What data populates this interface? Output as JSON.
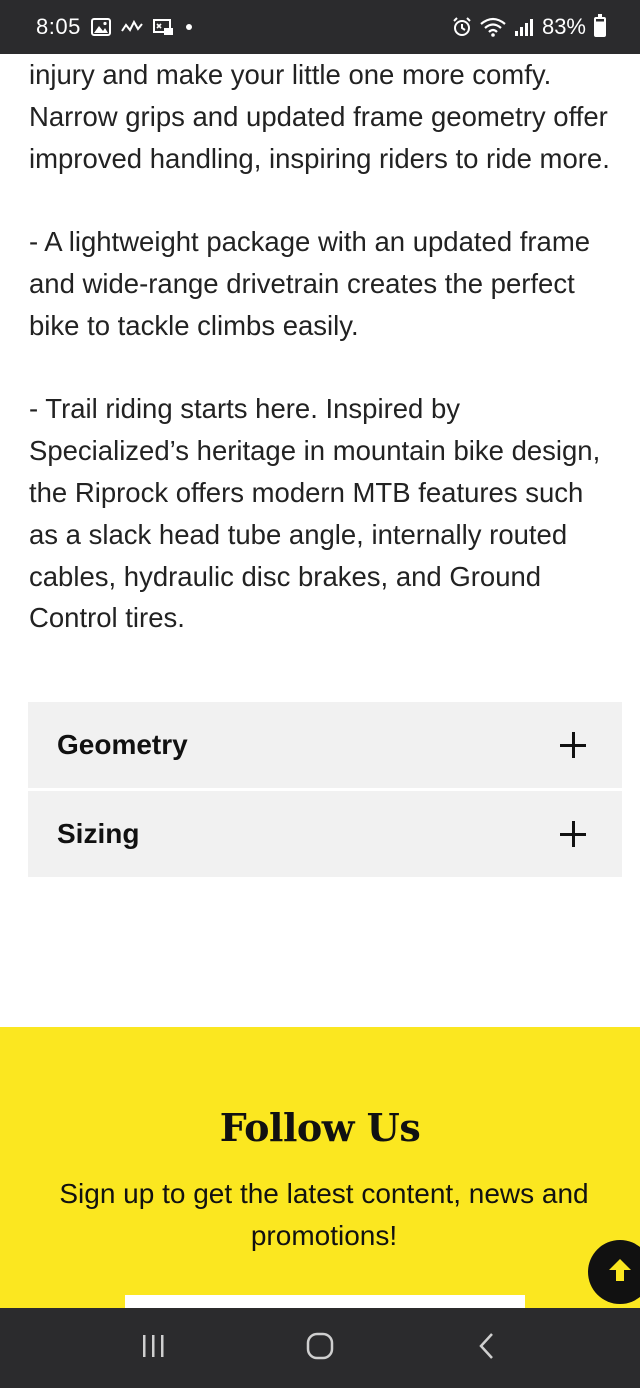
{
  "status_bar": {
    "time": "8:05",
    "battery": "83%",
    "left_icons": [
      "image-icon",
      "signal-activity-icon",
      "cast-icon",
      "dot-icon"
    ],
    "right_icons": [
      "alarm-icon",
      "wifi-icon",
      "cellular-signal-icon",
      "battery-icon"
    ]
  },
  "article": {
    "paragraph_1": "injury and make your little one more comfy. Narrow grips and updated frame geometry offer improved handling, inspiring riders to ride more.",
    "paragraph_2": "- A lightweight package with an updated frame and wide-range drivetrain creates the perfect bike to tackle climbs easily.",
    "paragraph_3": "- Trail riding starts here. Inspired by Specialized’s heritage in mountain bike design, the Riprock offers modern MTB features such as a slack head tube angle, internally routed cables, hydraulic disc brakes, and Ground Control tires."
  },
  "accordions": [
    {
      "label": "Geometry",
      "icon": "plus-icon"
    },
    {
      "label": "Sizing",
      "icon": "plus-icon"
    }
  ],
  "follow": {
    "title": "Follow Us",
    "subtitle": "Sign up to get the latest content, news and promotions!",
    "background": "#fbe720"
  },
  "nav_bar": {
    "buttons": [
      "recent-apps-icon",
      "home-icon",
      "back-icon"
    ]
  },
  "colors": {
    "status_bar": "#2b2b2d",
    "accordion_bg": "#f1f1f1",
    "accent_yellow": "#fbe720"
  }
}
